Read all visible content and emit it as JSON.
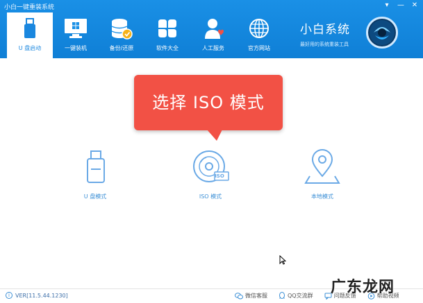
{
  "app": {
    "title": "小白一键重装系统"
  },
  "window": {
    "minimize_glyph": "▾",
    "restore_glyph": "—",
    "close_glyph": "✕"
  },
  "nav": {
    "items": [
      {
        "label": "U 盘启动",
        "icon": "usb-drive-icon",
        "active": true
      },
      {
        "label": "一键装机",
        "icon": "monitor-windows-icon"
      },
      {
        "label": "备份/还原",
        "icon": "database-icon"
      },
      {
        "label": "软件大全",
        "icon": "apps-clover-icon"
      },
      {
        "label": "人工服务",
        "icon": "support-agent-icon"
      },
      {
        "label": "官方网站",
        "icon": "globe-icon"
      }
    ]
  },
  "brand": {
    "name": "小白系统",
    "tagline": "最好用的系统重装工具"
  },
  "tooltip": {
    "text": "选择 ISO 模式"
  },
  "modes": [
    {
      "label": "U 盘模式",
      "icon": "usb-drive-icon"
    },
    {
      "label": "ISO 模式",
      "icon": "disc-iso-icon",
      "badge": "ISO"
    },
    {
      "label": "本地模式",
      "icon": "map-pin-icon"
    }
  ],
  "footer": {
    "version": "VER[11.5.44.1230]",
    "links": [
      {
        "label": "微信客服",
        "icon": "wechat-icon"
      },
      {
        "label": "QQ交流群",
        "icon": "qq-icon"
      },
      {
        "label": "问题反馈",
        "icon": "feedback-icon"
      },
      {
        "label": "帮助视频",
        "icon": "help-video-icon"
      }
    ]
  },
  "watermark": "广东龙网",
  "colors": {
    "header": "#1a90e6",
    "accent": "#3b8fd6",
    "tooltip": "#f25145"
  }
}
